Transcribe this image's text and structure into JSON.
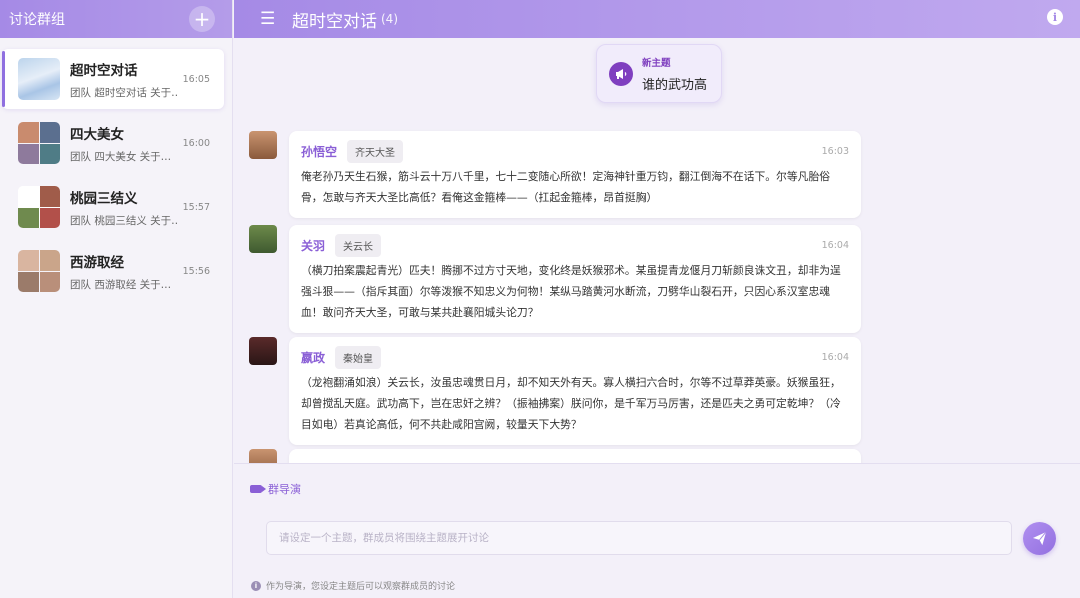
{
  "sidebar": {
    "title": "讨论群组",
    "add_symbol": "+",
    "conversations": [
      {
        "name": "超时空对话",
        "preview": "团队 超时空对话 关于…",
        "time": "16:05",
        "active": true
      },
      {
        "name": "四大美女",
        "preview": "团队 四大美女 关于…",
        "time": "16:00",
        "active": false
      },
      {
        "name": "桃园三结义",
        "preview": "团队 桃园三结义 关于…",
        "time": "15:57",
        "active": false
      },
      {
        "name": "西游取经",
        "preview": "团队 西游取经 关于…",
        "time": "15:56",
        "active": false
      }
    ]
  },
  "header": {
    "menu_symbol": "☰",
    "title": "超时空对话",
    "count": "(4)",
    "info_symbol": "i"
  },
  "topic": {
    "label": "新主题",
    "value": "谁的武功高"
  },
  "messages": [
    {
      "name": "孙悟空",
      "role": "齐天大圣",
      "time": "16:03",
      "text": "俺老孙乃天生石猴，筋斗云十万八千里，七十二变随心所欲！定海神针重万钧，翻江倒海不在话下。尔等凡胎俗骨，怎敢与齐天大圣比高低？看俺这金箍棒——（扛起金箍棒，昂首挺胸）"
    },
    {
      "name": "关羽",
      "role": "关云长",
      "time": "16:04",
      "text": "（横刀拍案震起青光）匹夫！腾挪不过方寸天地，变化终是妖猴邪术。某虽提青龙偃月刀斩颜良诛文丑，却非为逞强斗狠——（指斥其面）尔等泼猴不知忠义为何物！某纵马踏黄河水断流，刀劈华山裂石开，只因心系汉室忠魂血！敢问齐天大圣，可敢与某共赴襄阳城头论刀？"
    },
    {
      "name": "嬴政",
      "role": "秦始皇",
      "time": "16:04",
      "text": "（龙袍翻涌如浪）关云长，汝虽忠魂贯日月，却不知天外有天。寡人横扫六合时，尔等不过草莽英豪。妖猴虽狂，却曾搅乱天庭。武功高下，岂在忠奸之辨？（振袖拂案）朕问你，是千军万马厉害，还是匹夫之勇可定乾坤？（冷目如电）若真论高低，何不共赴咸阳宫阙，较量天下大势？"
    },
    {
      "name": "",
      "role": "",
      "time": "",
      "text": ""
    }
  ],
  "director": {
    "label": "群导演"
  },
  "composer": {
    "placeholder": "请设定一个主题，群成员将围绕主题展开讨论"
  },
  "hint": {
    "text": "作为导演，您设定主题后可以观察群成员的讨论"
  },
  "colors": {
    "accent": "#a58ae6",
    "accent_dark": "#8a5fd6",
    "topic_icon": "#7f3fbf"
  }
}
